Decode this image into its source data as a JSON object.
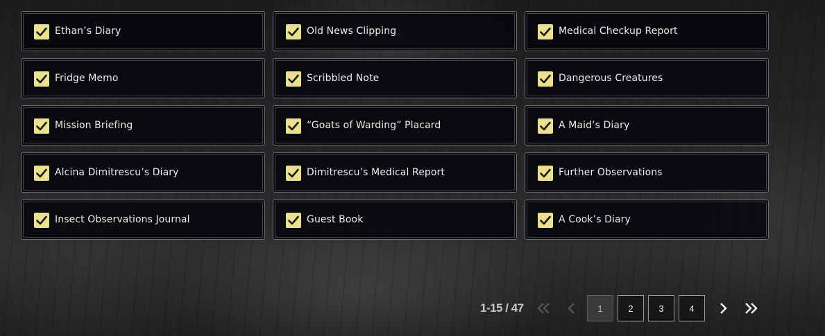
{
  "files": [
    {
      "label": "Ethan’s Diary",
      "checked": true
    },
    {
      "label": "Old News Clipping",
      "checked": true
    },
    {
      "label": "Medical Checkup Report",
      "checked": true
    },
    {
      "label": "Fridge Memo",
      "checked": true
    },
    {
      "label": "Scribbled Note",
      "checked": true
    },
    {
      "label": "Dangerous Creatures",
      "checked": true
    },
    {
      "label": "Mission Briefing",
      "checked": true
    },
    {
      "label": "“Goats of Warding” Placard",
      "checked": true
    },
    {
      "label": "A Maid’s Diary",
      "checked": true
    },
    {
      "label": "Alcina Dimitrescu’s Diary",
      "checked": true
    },
    {
      "label": "Dimitrescu’s Medical Report",
      "checked": true
    },
    {
      "label": "Further Observations",
      "checked": true
    },
    {
      "label": "Insect Observations Journal",
      "checked": true
    },
    {
      "label": "Guest Book",
      "checked": true
    },
    {
      "label": "A Cook’s Diary",
      "checked": true
    }
  ],
  "pagination": {
    "range_text": "1-15 / 47",
    "pages": [
      "1",
      "2",
      "3",
      "4"
    ],
    "current_page": "1",
    "first_icon": "double-chevron-left-icon",
    "prev_icon": "chevron-left-icon",
    "next_icon": "chevron-right-icon",
    "last_icon": "double-chevron-right-icon"
  },
  "colors": {
    "checkbox": "#eae08f",
    "checkmark": "#1a1a1a",
    "card_border": "#6e7178",
    "disabled_nav": "#5a5a5a",
    "enabled_nav": "#f2f2f2"
  }
}
